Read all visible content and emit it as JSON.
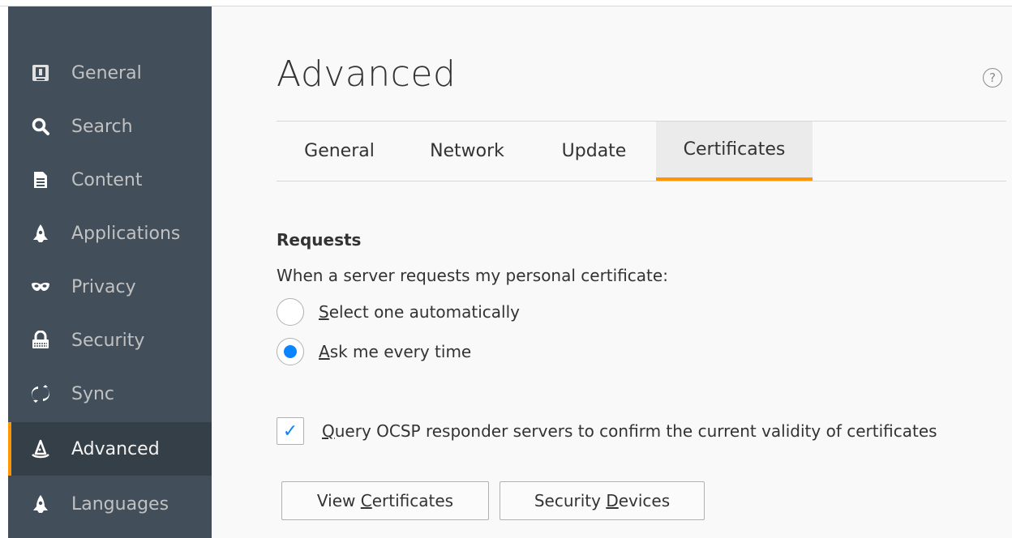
{
  "sidebar": {
    "items": [
      {
        "label": "General",
        "icon": "general-icon"
      },
      {
        "label": "Search",
        "icon": "search-icon"
      },
      {
        "label": "Content",
        "icon": "content-icon"
      },
      {
        "label": "Applications",
        "icon": "applications-icon"
      },
      {
        "label": "Privacy",
        "icon": "privacy-mask-icon"
      },
      {
        "label": "Security",
        "icon": "security-lock-icon"
      },
      {
        "label": "Sync",
        "icon": "sync-icon"
      },
      {
        "label": "Advanced",
        "icon": "advanced-wizard-hat-icon",
        "selected": true
      },
      {
        "label": "Languages",
        "icon": "languages-icon"
      }
    ]
  },
  "main": {
    "title": "Advanced",
    "help_icon": "?",
    "tabs": [
      {
        "label": "General"
      },
      {
        "label": "Network"
      },
      {
        "label": "Update"
      },
      {
        "label": "Certificates",
        "selected": true
      }
    ],
    "requests": {
      "title": "Requests",
      "description": "When a server requests my personal certificate:",
      "options": [
        {
          "accesskey": "S",
          "rest": "elect one automatically",
          "checked": false
        },
        {
          "accesskey": "A",
          "rest": "sk me every time",
          "checked": true
        }
      ]
    },
    "ocsp": {
      "accesskey": "Q",
      "rest": "uery OCSP responder servers to confirm the current validity of certificates",
      "checked": true,
      "check_glyph": "✓"
    },
    "buttons": {
      "view_certificates": {
        "before": "View ",
        "accesskey": "C",
        "after": "ertificates"
      },
      "security_devices": {
        "before": "Security ",
        "accesskey": "D",
        "after": "evices"
      }
    }
  },
  "colors": {
    "sidebar_bg": "#424f5a",
    "sidebar_selected_bg": "#343f48",
    "accent": "#ff9500",
    "radio_blue": "#0a84ff"
  }
}
